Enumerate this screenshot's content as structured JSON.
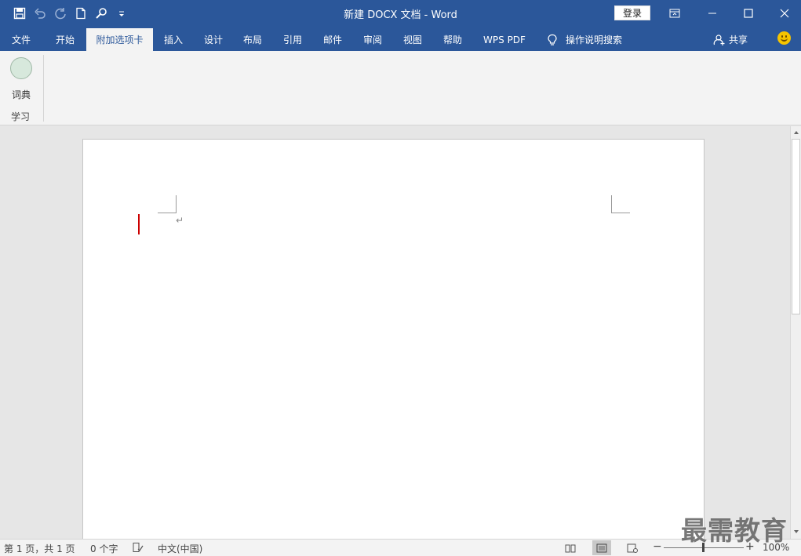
{
  "window": {
    "title": "新建 DOCX 文档  -  Word",
    "login_label": "登录"
  },
  "quick_access": [
    "save-icon",
    "undo-icon",
    "redo-icon",
    "new-document-icon",
    "find-icon",
    "customize-icon"
  ],
  "tabs": [
    {
      "label": "文件",
      "active": false
    },
    {
      "label": "开始",
      "active": false
    },
    {
      "label": "附加选项卡",
      "active": true
    },
    {
      "label": "插入",
      "active": false
    },
    {
      "label": "设计",
      "active": false
    },
    {
      "label": "布局",
      "active": false
    },
    {
      "label": "引用",
      "active": false
    },
    {
      "label": "邮件",
      "active": false
    },
    {
      "label": "审阅",
      "active": false
    },
    {
      "label": "视图",
      "active": false
    },
    {
      "label": "帮助",
      "active": false
    },
    {
      "label": "WPS PDF",
      "active": false
    }
  ],
  "tell_me": "操作说明搜索",
  "share_label": "共享",
  "ribbon": {
    "button_label": "词典",
    "group_label": "学习"
  },
  "document": {
    "paragraph_mark": "↵"
  },
  "status": {
    "page": "第 1 页，共 1 页",
    "words": "0 个字",
    "language": "中文(中国)",
    "zoom": "100%",
    "zoom_value": 100,
    "view_modes": [
      "read-mode",
      "print-layout",
      "web-layout"
    ],
    "active_view": "print-layout"
  },
  "watermark": "最需教育",
  "colors": {
    "accent": "#2b579a",
    "ribbon_bg": "#f3f3f3",
    "cursor": "#cc0000"
  }
}
